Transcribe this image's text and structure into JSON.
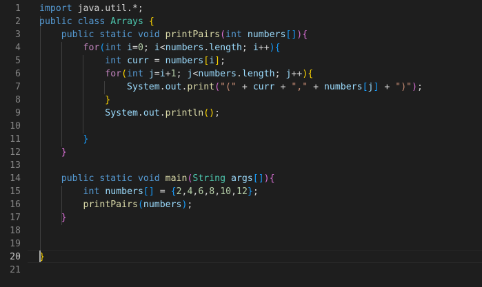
{
  "editor": {
    "line_numbers": [
      "1",
      "2",
      "3",
      "4",
      "5",
      "6",
      "7",
      "8",
      "9",
      "10",
      "11",
      "12",
      "13",
      "14",
      "15",
      "16",
      "17",
      "18",
      "19",
      "20",
      "21"
    ],
    "active_line": "20",
    "lines": [
      [
        {
          "t": "import",
          "c": "kw"
        },
        {
          "t": " java.util.*;",
          "c": "pl"
        }
      ],
      [
        {
          "t": "public",
          "c": "kw"
        },
        {
          "t": " ",
          "c": "pl"
        },
        {
          "t": "class",
          "c": "kw"
        },
        {
          "t": " ",
          "c": "pl"
        },
        {
          "t": "Arrays",
          "c": "ty"
        },
        {
          "t": " ",
          "c": "pl"
        },
        {
          "t": "{",
          "c": "b1"
        }
      ],
      [
        {
          "t": "    ",
          "c": "pl"
        },
        {
          "t": "public",
          "c": "kw"
        },
        {
          "t": " ",
          "c": "pl"
        },
        {
          "t": "static",
          "c": "kw"
        },
        {
          "t": " ",
          "c": "pl"
        },
        {
          "t": "void",
          "c": "kw"
        },
        {
          "t": " ",
          "c": "pl"
        },
        {
          "t": "printPairs",
          "c": "fn"
        },
        {
          "t": "(",
          "c": "b2"
        },
        {
          "t": "int",
          "c": "kw"
        },
        {
          "t": " ",
          "c": "pl"
        },
        {
          "t": "numbers",
          "c": "var"
        },
        {
          "t": "[]",
          "c": "b3"
        },
        {
          "t": ")",
          "c": "b2"
        },
        {
          "t": "{",
          "c": "b2"
        }
      ],
      [
        {
          "t": "        ",
          "c": "pl"
        },
        {
          "t": "for",
          "c": "ctl"
        },
        {
          "t": "(",
          "c": "b3"
        },
        {
          "t": "int",
          "c": "kw"
        },
        {
          "t": " ",
          "c": "pl"
        },
        {
          "t": "i",
          "c": "var"
        },
        {
          "t": "=",
          "c": "pl"
        },
        {
          "t": "0",
          "c": "num"
        },
        {
          "t": "; ",
          "c": "pl"
        },
        {
          "t": "i",
          "c": "var"
        },
        {
          "t": "<",
          "c": "pl"
        },
        {
          "t": "numbers",
          "c": "var"
        },
        {
          "t": ".",
          "c": "pl"
        },
        {
          "t": "length",
          "c": "var"
        },
        {
          "t": "; ",
          "c": "pl"
        },
        {
          "t": "i",
          "c": "var"
        },
        {
          "t": "++",
          "c": "pl"
        },
        {
          "t": ")",
          "c": "b3"
        },
        {
          "t": "{",
          "c": "b3"
        }
      ],
      [
        {
          "t": "            ",
          "c": "pl"
        },
        {
          "t": "int",
          "c": "kw"
        },
        {
          "t": " ",
          "c": "pl"
        },
        {
          "t": "curr",
          "c": "var"
        },
        {
          "t": " = ",
          "c": "pl"
        },
        {
          "t": "numbers",
          "c": "var"
        },
        {
          "t": "[",
          "c": "b1"
        },
        {
          "t": "i",
          "c": "var"
        },
        {
          "t": "]",
          "c": "b1"
        },
        {
          "t": ";",
          "c": "pl"
        }
      ],
      [
        {
          "t": "            ",
          "c": "pl"
        },
        {
          "t": "for",
          "c": "ctl"
        },
        {
          "t": "(",
          "c": "b1"
        },
        {
          "t": "int",
          "c": "kw"
        },
        {
          "t": " ",
          "c": "pl"
        },
        {
          "t": "j",
          "c": "var"
        },
        {
          "t": "=",
          "c": "pl"
        },
        {
          "t": "i",
          "c": "var"
        },
        {
          "t": "+",
          "c": "pl"
        },
        {
          "t": "1",
          "c": "num"
        },
        {
          "t": "; ",
          "c": "pl"
        },
        {
          "t": "j",
          "c": "var"
        },
        {
          "t": "<",
          "c": "pl"
        },
        {
          "t": "numbers",
          "c": "var"
        },
        {
          "t": ".",
          "c": "pl"
        },
        {
          "t": "length",
          "c": "var"
        },
        {
          "t": "; ",
          "c": "pl"
        },
        {
          "t": "j",
          "c": "var"
        },
        {
          "t": "++",
          "c": "pl"
        },
        {
          "t": ")",
          "c": "b1"
        },
        {
          "t": "{",
          "c": "b1"
        }
      ],
      [
        {
          "t": "                ",
          "c": "pl"
        },
        {
          "t": "System",
          "c": "var"
        },
        {
          "t": ".",
          "c": "pl"
        },
        {
          "t": "out",
          "c": "var"
        },
        {
          "t": ".",
          "c": "pl"
        },
        {
          "t": "print",
          "c": "fn"
        },
        {
          "t": "(",
          "c": "b2"
        },
        {
          "t": "\"(\"",
          "c": "str"
        },
        {
          "t": " + ",
          "c": "pl"
        },
        {
          "t": "curr",
          "c": "var"
        },
        {
          "t": " + ",
          "c": "pl"
        },
        {
          "t": "\",\"",
          "c": "str"
        },
        {
          "t": " + ",
          "c": "pl"
        },
        {
          "t": "numbers",
          "c": "var"
        },
        {
          "t": "[",
          "c": "b3"
        },
        {
          "t": "j",
          "c": "var"
        },
        {
          "t": "]",
          "c": "b3"
        },
        {
          "t": " + ",
          "c": "pl"
        },
        {
          "t": "\")\"",
          "c": "str"
        },
        {
          "t": ")",
          "c": "b2"
        },
        {
          "t": ";",
          "c": "pl"
        }
      ],
      [
        {
          "t": "            ",
          "c": "pl"
        },
        {
          "t": "}",
          "c": "b1"
        }
      ],
      [
        {
          "t": "            ",
          "c": "pl"
        },
        {
          "t": "System",
          "c": "var"
        },
        {
          "t": ".",
          "c": "pl"
        },
        {
          "t": "out",
          "c": "var"
        },
        {
          "t": ".",
          "c": "pl"
        },
        {
          "t": "println",
          "c": "fn"
        },
        {
          "t": "()",
          "c": "b1"
        },
        {
          "t": ";",
          "c": "pl"
        }
      ],
      [],
      [
        {
          "t": "        ",
          "c": "pl"
        },
        {
          "t": "}",
          "c": "b3"
        }
      ],
      [
        {
          "t": "    ",
          "c": "pl"
        },
        {
          "t": "}",
          "c": "b2"
        }
      ],
      [],
      [
        {
          "t": "    ",
          "c": "pl"
        },
        {
          "t": "public",
          "c": "kw"
        },
        {
          "t": " ",
          "c": "pl"
        },
        {
          "t": "static",
          "c": "kw"
        },
        {
          "t": " ",
          "c": "pl"
        },
        {
          "t": "void",
          "c": "kw"
        },
        {
          "t": " ",
          "c": "pl"
        },
        {
          "t": "main",
          "c": "fn"
        },
        {
          "t": "(",
          "c": "b2"
        },
        {
          "t": "String",
          "c": "ty"
        },
        {
          "t": " ",
          "c": "pl"
        },
        {
          "t": "args",
          "c": "var"
        },
        {
          "t": "[]",
          "c": "b3"
        },
        {
          "t": ")",
          "c": "b2"
        },
        {
          "t": "{",
          "c": "b2"
        }
      ],
      [
        {
          "t": "        ",
          "c": "pl"
        },
        {
          "t": "int",
          "c": "kw"
        },
        {
          "t": " ",
          "c": "pl"
        },
        {
          "t": "numbers",
          "c": "var"
        },
        {
          "t": "[]",
          "c": "b3"
        },
        {
          "t": " = ",
          "c": "pl"
        },
        {
          "t": "{",
          "c": "b3"
        },
        {
          "t": "2",
          "c": "num"
        },
        {
          "t": ",",
          "c": "pl"
        },
        {
          "t": "4",
          "c": "num"
        },
        {
          "t": ",",
          "c": "pl"
        },
        {
          "t": "6",
          "c": "num"
        },
        {
          "t": ",",
          "c": "pl"
        },
        {
          "t": "8",
          "c": "num"
        },
        {
          "t": ",",
          "c": "pl"
        },
        {
          "t": "10",
          "c": "num"
        },
        {
          "t": ",",
          "c": "pl"
        },
        {
          "t": "12",
          "c": "num"
        },
        {
          "t": "}",
          "c": "b3"
        },
        {
          "t": ";",
          "c": "pl"
        }
      ],
      [
        {
          "t": "        ",
          "c": "pl"
        },
        {
          "t": "printPairs",
          "c": "fn"
        },
        {
          "t": "(",
          "c": "b3"
        },
        {
          "t": "numbers",
          "c": "var"
        },
        {
          "t": ")",
          "c": "b3"
        },
        {
          "t": ";",
          "c": "pl"
        }
      ],
      [
        {
          "t": "    ",
          "c": "pl"
        },
        {
          "t": "}",
          "c": "b2"
        }
      ],
      [],
      [],
      [
        {
          "t": "}",
          "c": "b1"
        }
      ],
      []
    ]
  }
}
